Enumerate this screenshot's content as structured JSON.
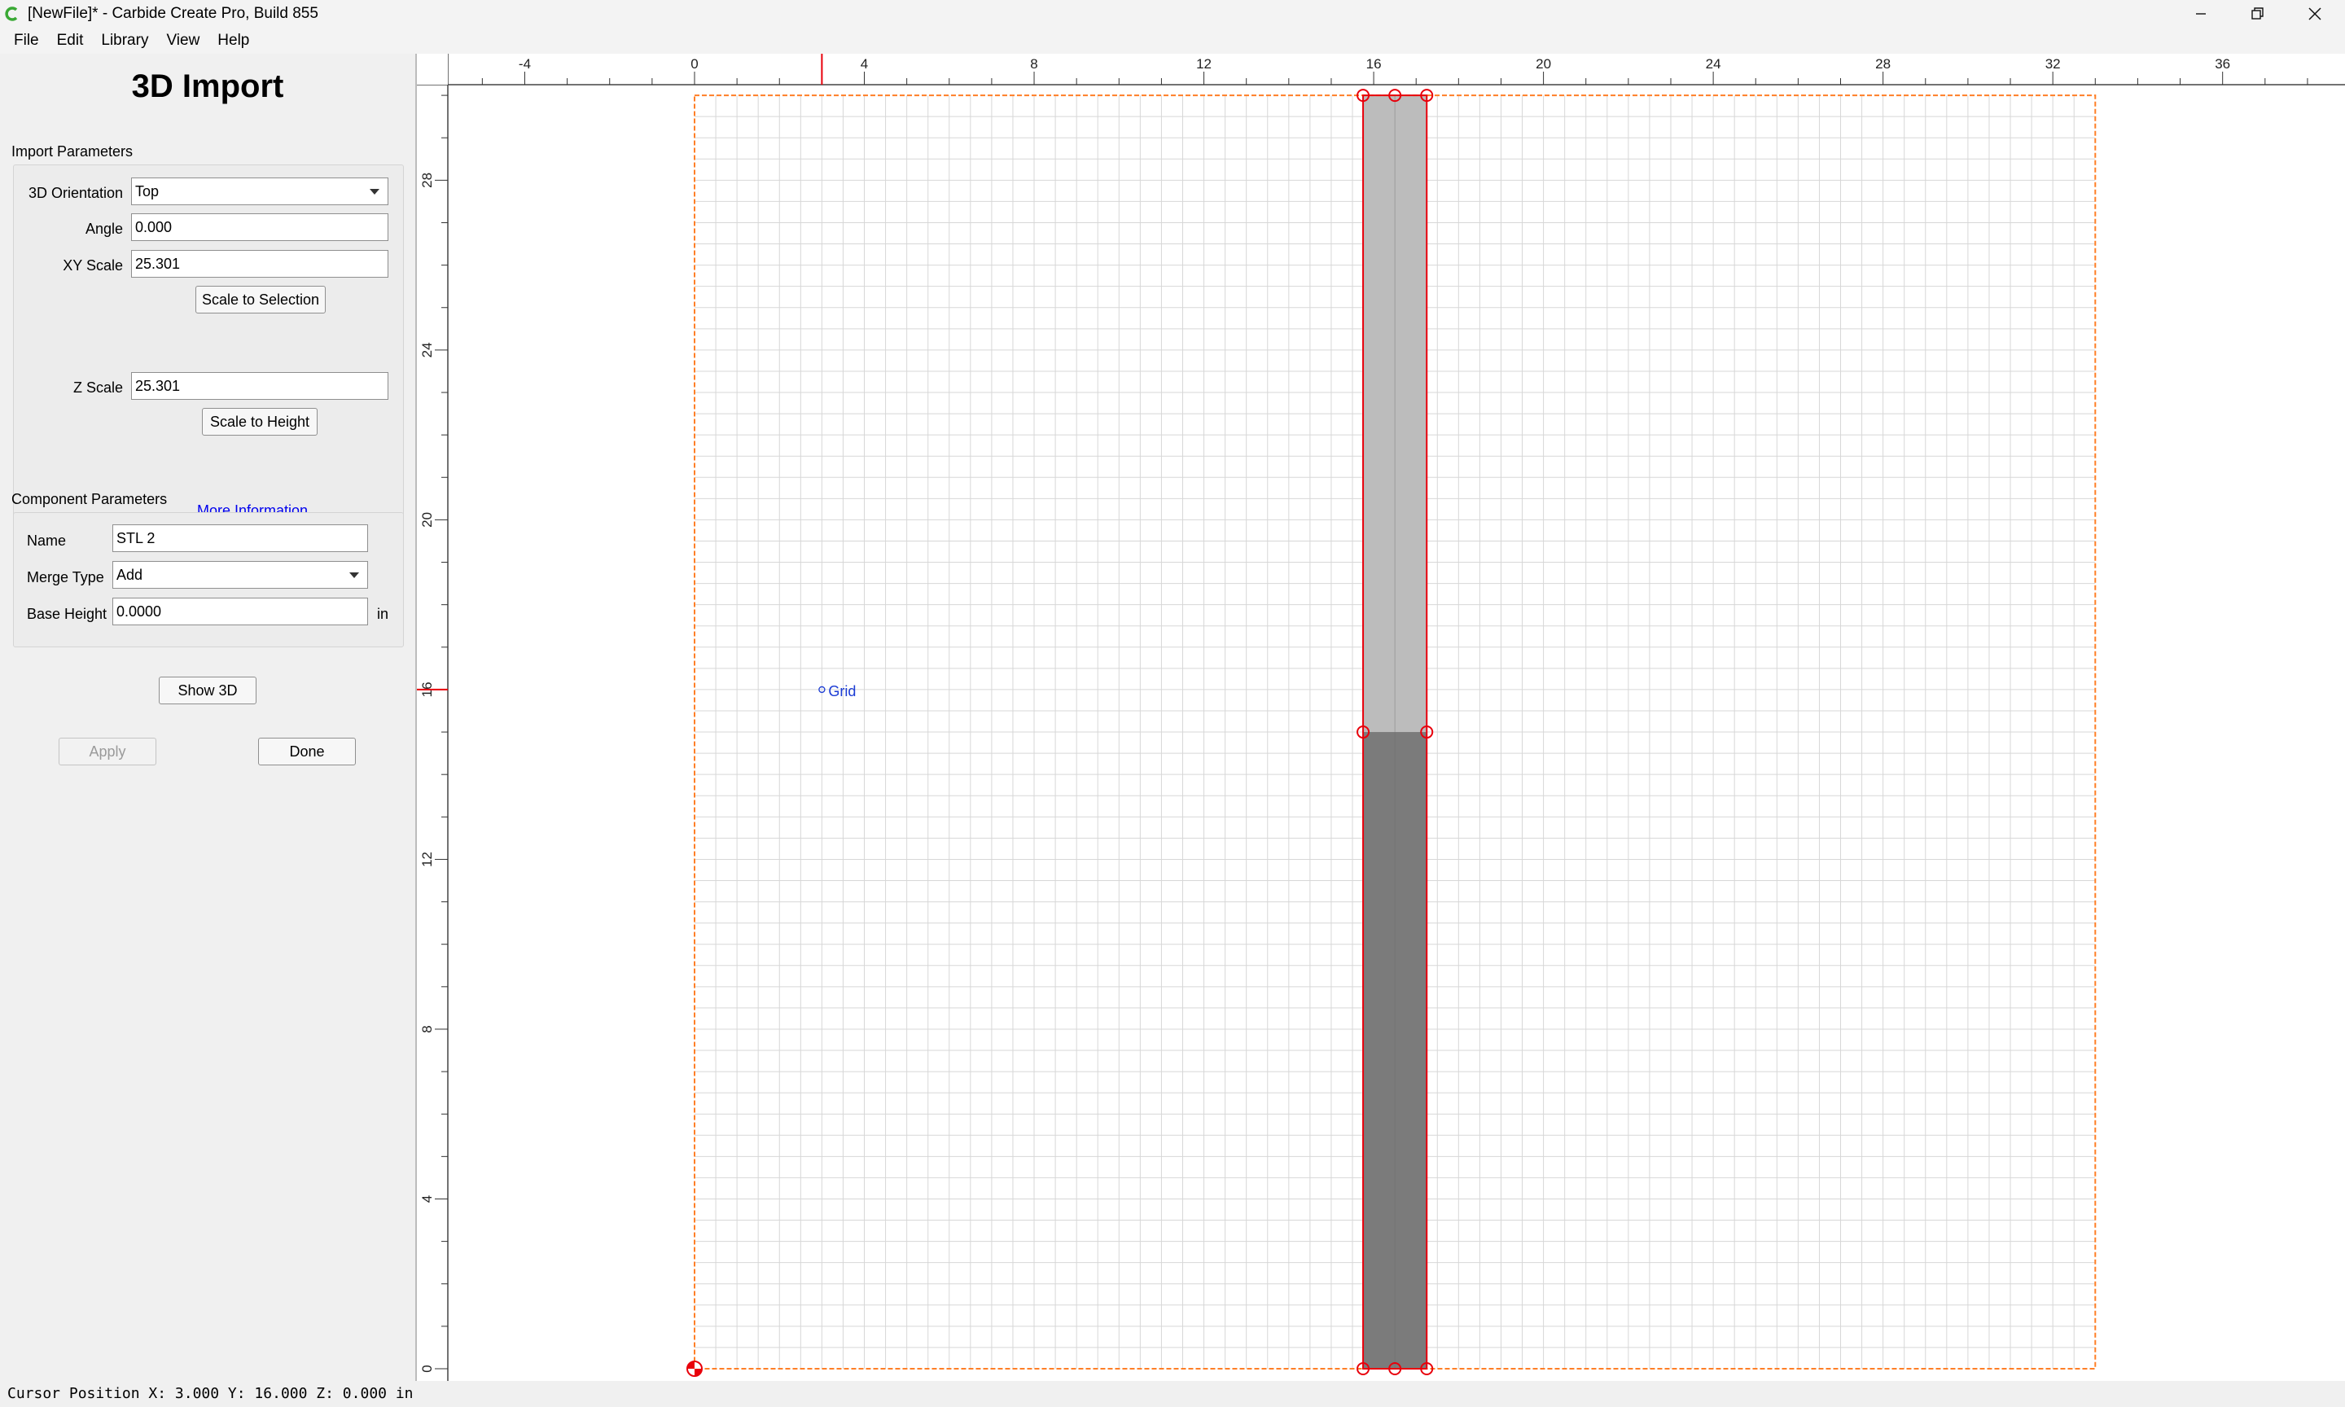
{
  "window": {
    "title": "[NewFile]* - Carbide Create Pro, Build 855",
    "controls": [
      "minimize-icon",
      "restore-icon",
      "close-icon"
    ]
  },
  "menu": {
    "items": [
      {
        "label": "File"
      },
      {
        "label": "Edit"
      },
      {
        "label": "Library"
      },
      {
        "label": "View"
      },
      {
        "label": "Help"
      }
    ]
  },
  "panel": {
    "title": "3D Import",
    "import_params": {
      "section_label": "Import Parameters",
      "orientation_label": "3D Orientation",
      "orientation_value": "Top",
      "angle_label": "Angle",
      "angle_value": "0.000",
      "xy_scale_label": "XY Scale",
      "xy_scale_value": "25.301",
      "scale_to_selection": "Scale to Selection",
      "z_scale_label": "Z Scale",
      "z_scale_value": "25.301",
      "scale_to_height": "Scale to Height",
      "more_info": "More Information..."
    },
    "component_params": {
      "section_label": "Component Parameters",
      "name_label": "Name",
      "name_value": "STL 2",
      "merge_type_label": "Merge Type",
      "merge_type_value": "Add",
      "base_height_label": "Base Height",
      "base_height_value": "0.0000",
      "unit": "in"
    },
    "show_3d": "Show 3D",
    "apply": "Apply",
    "done": "Done"
  },
  "canvas": {
    "x_ticks": [
      "-4",
      "0",
      "4",
      "8",
      "12",
      "16",
      "20",
      "24",
      "28",
      "32",
      "36"
    ],
    "y_ticks": [
      "0",
      "4",
      "8",
      "12",
      "16",
      "20",
      "24",
      "28"
    ],
    "grid_label": "Grid",
    "stock_width": 33,
    "stock_height": 30,
    "model": {
      "x_min": 15.75,
      "x_max": 17.25,
      "y_min": 0,
      "y_max": 30
    },
    "cursor": {
      "x": 3.0,
      "y": 16.0
    },
    "colors": {
      "stock_border": "#ff7f27",
      "selection": "#e8000b",
      "grid_line": "#d7d7d7",
      "model_light": "#bcbcbc",
      "model_dark": "#7b7b7b",
      "label": "#1a3bd4"
    }
  },
  "status": {
    "text": "Cursor Position X: 3.000 Y: 16.000 Z: 0.000 in"
  }
}
